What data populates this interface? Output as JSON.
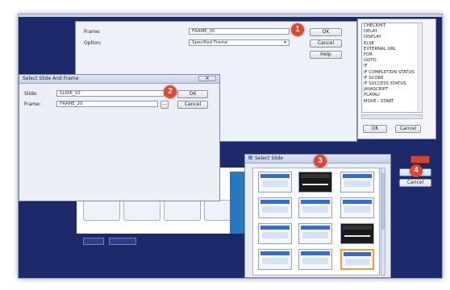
{
  "frame_dialog": {
    "frame_label": "Frame:",
    "frame_value": "FRAME_20",
    "option_label": "Option:",
    "option_value": "Specified Frame",
    "ok": "OK",
    "cancel": "Cancel",
    "help": "Help"
  },
  "action_list": {
    "items": [
      "CHECKHIT",
      "DELAY",
      "DISPLAY",
      "ELSE",
      "EXTERNAL URL",
      "FOR",
      "GOTO",
      "IF",
      "IF COMPLETION STATUS",
      "IF SCORE",
      "IF SUCCESS STATUS",
      "JAVASCRIPT",
      "PLAYAU",
      "MOVE - START"
    ],
    "ok": "OK",
    "cancel": "Cancel"
  },
  "select_slide_and_frame": {
    "title": "Select Slide And Frame",
    "slide_label": "Slide:",
    "slide_value": "SLIDE_10",
    "frame_label": "Frame:",
    "frame_value": "FRAME_20",
    "browse": "...",
    "ok": "OK",
    "cancel": "Cancel"
  },
  "select_slide": {
    "title": "Select Slide",
    "ok": "OK",
    "cancel": "Cancel"
  },
  "callouts": [
    "1",
    "2",
    "3",
    "4"
  ],
  "colors": {
    "callout": "#e0462f",
    "selection": "#f39a3c",
    "stage_bg": "#1c2a6c"
  }
}
